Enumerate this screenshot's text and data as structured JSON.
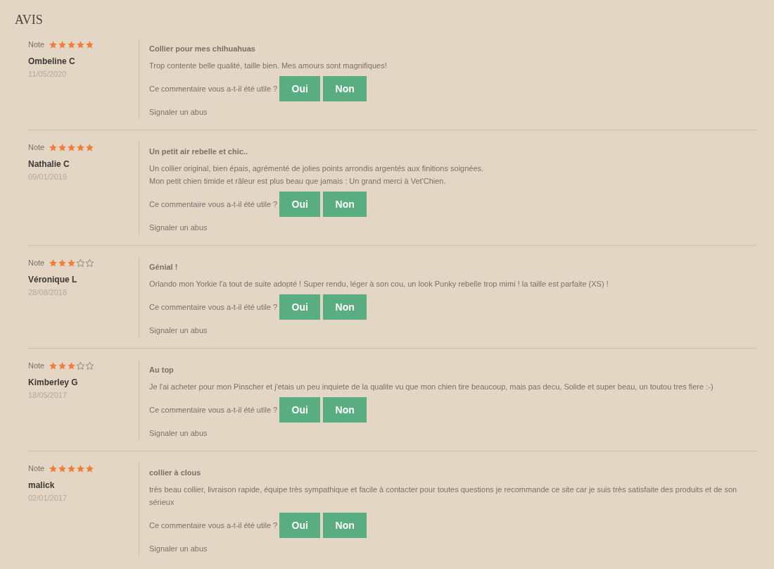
{
  "heading": "AVIS",
  "reviews": [
    {
      "note_label": "Note",
      "stars": 5,
      "author": "Ombeline C",
      "date": "11/05/2020",
      "title": "Collier pour mes chihuahuas",
      "body": [
        "Trop contente belle qualité, taille bien. Mes amours sont magnifiques!"
      ],
      "question": "Ce commentaire vous a-t-il été utile ?",
      "yes": "Oui",
      "no": "Non",
      "report": "Signaler un abus"
    },
    {
      "note_label": "Note",
      "stars": 5,
      "author": "Nathalie C",
      "date": "09/01/2019",
      "title": "Un petit air rebelle et chic..",
      "body": [
        "Un collier original, bien épais, agrémenté de jolies points arrondis argentés aux finitions soignées.",
        "Mon petit chien timide et râleur est plus beau que jamais : Un grand merci à Vet'Chien."
      ],
      "question": "Ce commentaire vous a-t-il été utile ?",
      "yes": "Oui",
      "no": "Non",
      "report": "Signaler un abus"
    },
    {
      "note_label": "Note",
      "stars": 3,
      "author": "Véronique L",
      "date": "28/08/2018",
      "title": "Génial !",
      "body": [
        "Orlando mon Yorkie l'a tout de suite adopté ! Super rendu, léger à son cou, un look Punky rebelle trop mimi ! la taille est parfaite (XS) !"
      ],
      "question": "Ce commentaire vous a-t-il été utile ?",
      "yes": "Oui",
      "no": "Non",
      "report": "Signaler un abus"
    },
    {
      "note_label": "Note",
      "stars": 3,
      "author": "Kimberley G",
      "date": "18/05/2017",
      "title": "Au top",
      "body": [
        "Je l'ai acheter pour mon Pinscher et j'etais un peu inquiete de la qualite vu que mon chien tire beaucoup, mais pas decu, Solide et super beau, un toutou tres fiere :-)"
      ],
      "question": "Ce commentaire vous a-t-il été utile ?",
      "yes": "Oui",
      "no": "Non",
      "report": "Signaler un abus"
    },
    {
      "note_label": "Note",
      "stars": 5,
      "author": "malick",
      "date": "02/01/2017",
      "title": "collier à clous",
      "body": [
        "très beau collier, livraison rapide, équipe très sympathique et facile à contacter pour toutes questions je recommande ce site car je suis très satisfaite des produits et de son sérieux"
      ],
      "question": "Ce commentaire vous a-t-il été utile ?",
      "yes": "Oui",
      "no": "Non",
      "report": "Signaler un abus"
    }
  ]
}
